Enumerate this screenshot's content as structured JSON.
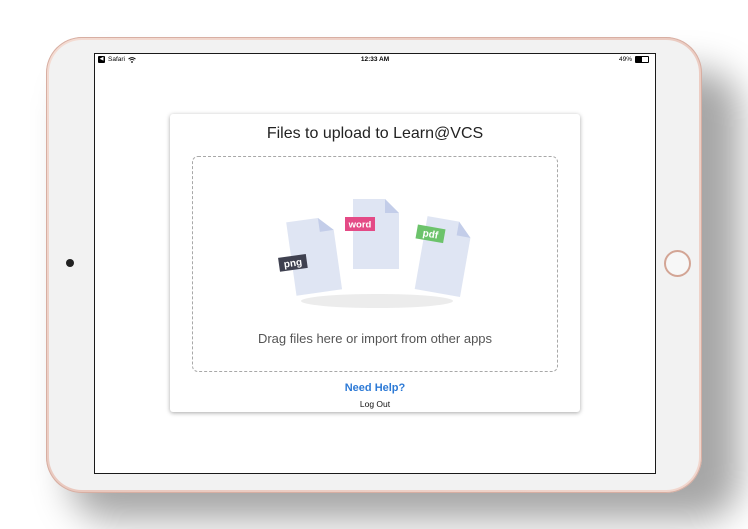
{
  "status_bar": {
    "back_app": "Safari",
    "time": "12:33 AM",
    "battery": "49%",
    "battery_level": 0.49
  },
  "upload_card": {
    "title": "Files to upload to Learn@VCS",
    "file_types": [
      "png",
      "word",
      "pdf"
    ],
    "drop_text": "Drag files here or import from other apps",
    "help_link": "Need Help?",
    "logout": "Log Out"
  },
  "colors": {
    "png_tag": "#3f4150",
    "word_tag": "#e44a86",
    "pdf_tag": "#6cc36b",
    "file_fill": "#dfe5f3",
    "file_fold": "#c3cde9",
    "link": "#2d7ad6"
  }
}
